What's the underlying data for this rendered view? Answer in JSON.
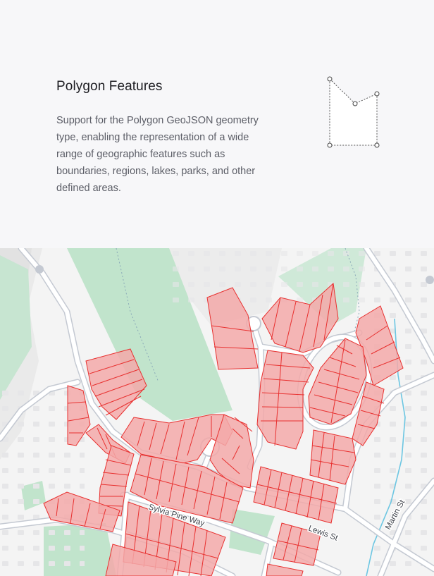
{
  "feature": {
    "title": "Polygon Features",
    "description": "Support for the Polygon GeoJSON geometry type, enabling the representation of a wide range of geographic features such as boundaries, regions, lakes, parks, and other defined areas."
  },
  "icons": {
    "feature_icon": "polygon-shape-icon"
  },
  "map": {
    "streets": [
      "Sylvia Pine Way",
      "Lewis St",
      "Martin St"
    ]
  },
  "colors": {
    "polygon_fill": "#f3a9a9",
    "polygon_stroke": "#e8302f",
    "park": "#bfe3cb",
    "road": "#ffffff",
    "road_casing": "#c4c9d2",
    "water": "#6cc6e2"
  }
}
